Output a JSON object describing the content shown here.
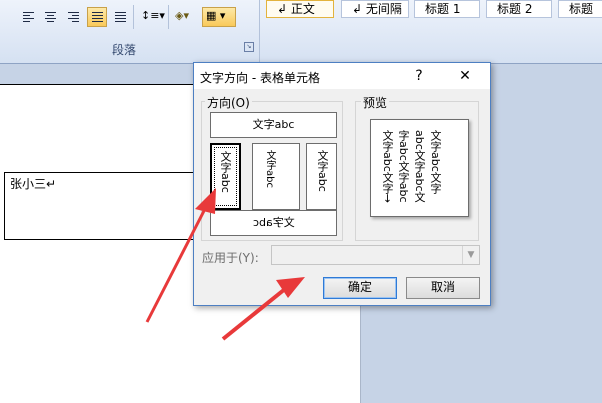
{
  "ribbon": {
    "paragraph_group_label": "段落",
    "styles": [
      "↲ 正文",
      "↲ 无间隔",
      "标题 1",
      "标题 2",
      "标题"
    ]
  },
  "document": {
    "cell_text": "张小三↵"
  },
  "dialog": {
    "title": "文字方向 - 表格单元格",
    "help": "?",
    "close": "✕",
    "orientation_label": "方向(O)",
    "preview_label": "预览",
    "options": {
      "horizontal": "文字abc",
      "vertical_rotated": "文字abc",
      "vertical_stacked": "文字abc",
      "vertical_rl": "文字abc",
      "horizontal_flipped": "文字abc"
    },
    "preview_text": "文字abc文字abc文字abc文字abc文字abc文字abc文字→",
    "apply_to_label": "应用于(Y):",
    "apply_to_value": "",
    "ok": "确定",
    "cancel": "取消"
  },
  "colors": {
    "arrow": "#e8393a",
    "dialog_border": "#4d7fc2",
    "ribbon_bg": "#d5e1f2",
    "workspace_bg": "#c6d3e6"
  }
}
